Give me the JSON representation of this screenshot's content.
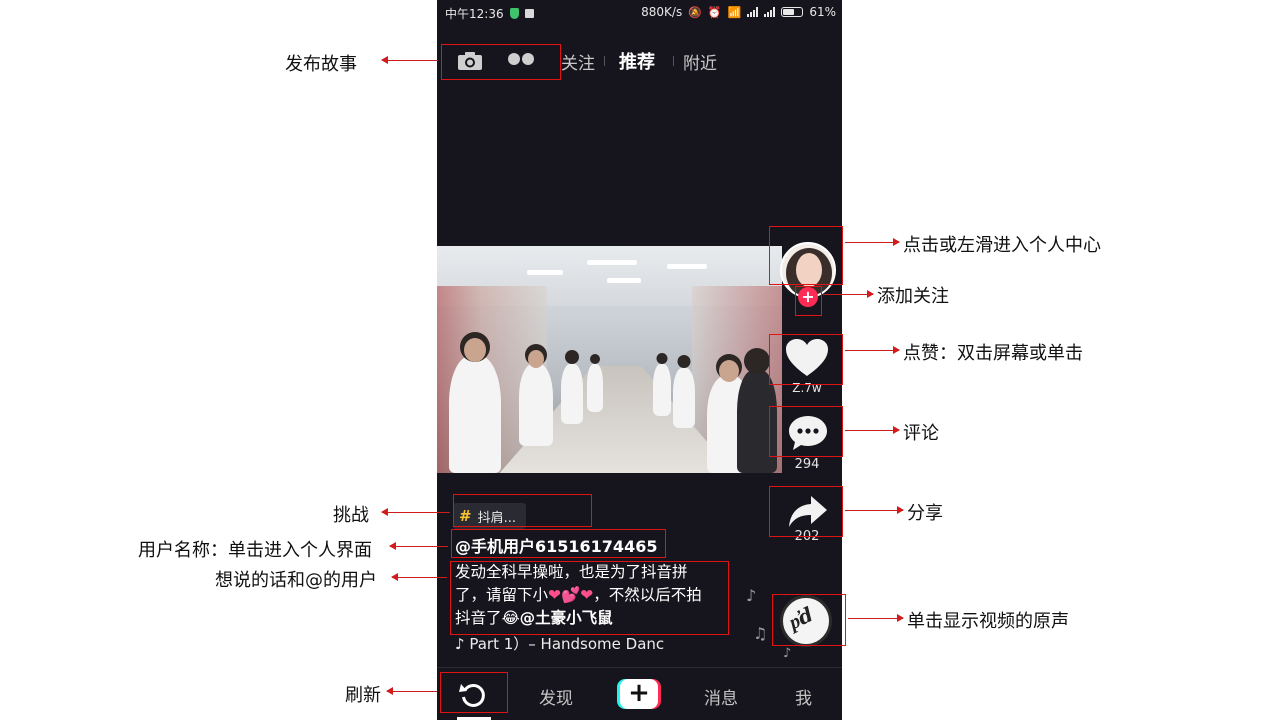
{
  "status_bar": {
    "time": "中午12:36",
    "net_speed": "880K/s",
    "battery": "61%",
    "battery_level": 0.61
  },
  "top_tabs": {
    "follow": "关注",
    "recommend": "推荐",
    "nearby": "附近"
  },
  "side_actions": {
    "likes": "Z.7w",
    "comments": "294",
    "shares": "202"
  },
  "post": {
    "challenge": "抖肩...",
    "username": "@手机用户61516174465",
    "caption_line1": "发动全科早操啦，也是为了抖音拼",
    "caption_line2_a": "了，请留下小",
    "caption_line2_hearts": "❤💕❤",
    "caption_line2_b": "，不然以后不拍",
    "caption_line3_a": "抖音了",
    "caption_line3_mention": "@土豪小飞鼠",
    "music_note": "♪",
    "music": "Part 1）– Handsome Danc"
  },
  "bottom_nav": {
    "discover": "发现",
    "plus": "+",
    "messages": "消息",
    "me": "我"
  },
  "annotations": {
    "post_story": "发布故事",
    "profile": "点击或左滑进入个人中心",
    "follow": "添加关注",
    "like": "点赞：双击屏幕或单击",
    "comment": "评论",
    "share": "分享",
    "challenge": "挑战",
    "username": "用户名称：单击进入个人界面",
    "caption": "想说的话和@的用户",
    "sound": "单击显示视频的原声",
    "refresh": "刷新"
  },
  "colors": {
    "accent_red": "#fe2c55",
    "annotation_red": "#e01414",
    "tag_yellow": "#f8c42f",
    "background": "#16151d"
  }
}
